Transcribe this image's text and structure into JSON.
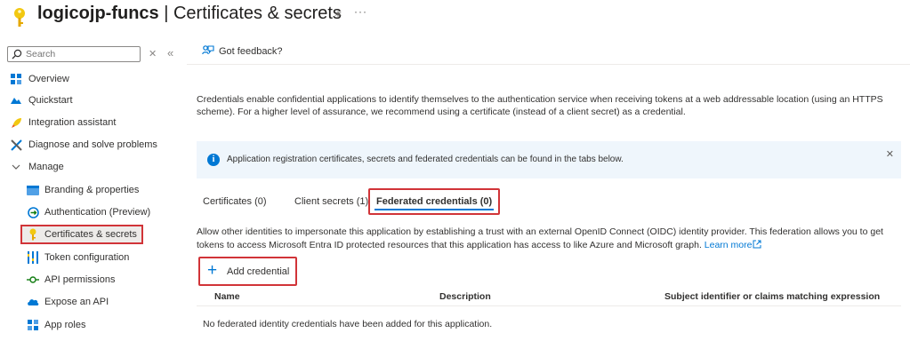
{
  "header": {
    "title_bold": "logicojp-funcs",
    "title_rest": " | Certificates & secrets"
  },
  "sidebar": {
    "search": {
      "placeholder": "Search"
    },
    "items": [
      {
        "label": "Overview",
        "icon": "overview-icon"
      },
      {
        "label": "Quickstart",
        "icon": "quickstart-icon"
      },
      {
        "label": "Integration assistant",
        "icon": "rocket-icon"
      },
      {
        "label": "Diagnose and solve problems",
        "icon": "wrench-icon"
      },
      {
        "label": "Manage",
        "icon": "chevron-down-icon"
      },
      {
        "label": "Branding & properties",
        "icon": "branding-icon"
      },
      {
        "label": "Authentication (Preview)",
        "icon": "authentication-icon"
      },
      {
        "label": "Certificates & secrets",
        "icon": "key-icon",
        "selected": true
      },
      {
        "label": "Token configuration",
        "icon": "token-icon"
      },
      {
        "label": "API permissions",
        "icon": "api-permissions-icon"
      },
      {
        "label": "Expose an API",
        "icon": "cloud-icon"
      },
      {
        "label": "App roles",
        "icon": "app-roles-icon"
      }
    ]
  },
  "main": {
    "feedback_label": "Got feedback?",
    "intro": "Credentials enable confidential applications to identify themselves to the authentication service when receiving tokens at a web addressable location (using an HTTPS scheme). For a higher level of assurance, we recommend using a certificate (instead of a client secret) as a credential.",
    "info_text": "Application registration certificates, secrets and federated credentials can be found in the tabs below.",
    "tabs": [
      {
        "label": "Certificates (0)"
      },
      {
        "label": "Client secrets (1)"
      },
      {
        "label": "Federated credentials (0)",
        "active": true
      }
    ],
    "federated_description": "Allow other identities to impersonate this application by establishing a trust with an external OpenID Connect (OIDC) identity provider. This federation allows you to get tokens to access Microsoft Entra ID protected resources that this application has access to like Azure and Microsoft graph.",
    "learn_more": "Learn more",
    "add_credential_label": "Add credential",
    "table": {
      "columns": [
        "Name",
        "Description",
        "Subject identifier or claims matching expression"
      ],
      "empty_message": "No federated identity credentials have been added for this application."
    }
  },
  "colors": {
    "accent": "#0078d4",
    "highlight_border": "#d13438",
    "key_yellow": "#f2c811",
    "info_bg": "#eff6fc"
  }
}
